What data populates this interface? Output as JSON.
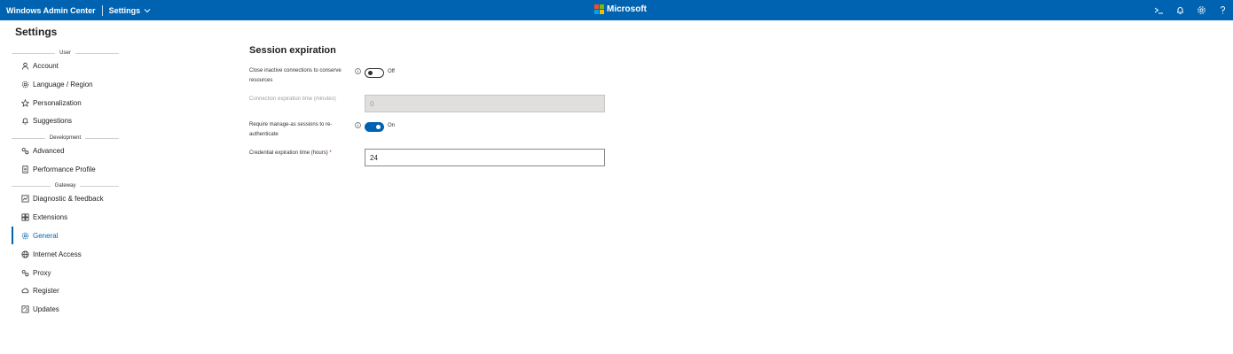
{
  "header": {
    "app_title": "Windows Admin Center",
    "breadcrumb": "Settings",
    "brand": "Microsoft",
    "brand_colors": [
      "#f25022",
      "#7fba00",
      "#00a4ef",
      "#ffb900"
    ],
    "bar_color": "#0063b1",
    "icons": [
      "powershell-icon",
      "notifications-icon",
      "settings-icon",
      "help-icon"
    ]
  },
  "sidebar": {
    "title": "Settings",
    "groups": [
      {
        "label": "User",
        "items": [
          {
            "label": "Account",
            "icon": "person-icon"
          },
          {
            "label": "Language / Region",
            "icon": "gear-icon"
          },
          {
            "label": "Personalization",
            "icon": "star-icon"
          },
          {
            "label": "Suggestions",
            "icon": "bell-icon"
          }
        ]
      },
      {
        "label": "Development",
        "items": [
          {
            "label": "Advanced",
            "icon": "advanced-icon"
          },
          {
            "label": "Performance Profile",
            "icon": "document-icon"
          }
        ]
      },
      {
        "label": "Gateway",
        "items": [
          {
            "label": "Diagnostic & feedback",
            "icon": "diagnostic-icon"
          },
          {
            "label": "Extensions",
            "icon": "extensions-icon"
          },
          {
            "label": "General",
            "icon": "gear-icon",
            "active": true
          },
          {
            "label": "Internet Access",
            "icon": "globe-icon"
          },
          {
            "label": "Proxy",
            "icon": "proxy-icon"
          },
          {
            "label": "Register",
            "icon": "cloud-icon"
          },
          {
            "label": "Updates",
            "icon": "updates-icon"
          }
        ]
      }
    ]
  },
  "main": {
    "section_title": "Session expiration",
    "close_inactive": {
      "label": "Close inactive connections to conserve resources",
      "state": "Off",
      "checked": false
    },
    "connection_expiration": {
      "label": "Connection expiration time (minutes)",
      "value": "0",
      "disabled": true
    },
    "require_manage_as": {
      "label": "Require manage-as sessions to re-authenticate",
      "state": "On",
      "checked": true
    },
    "credential_expiration": {
      "label": "Credential expiration time (hours)",
      "required_mark": "*",
      "value": "24"
    }
  }
}
